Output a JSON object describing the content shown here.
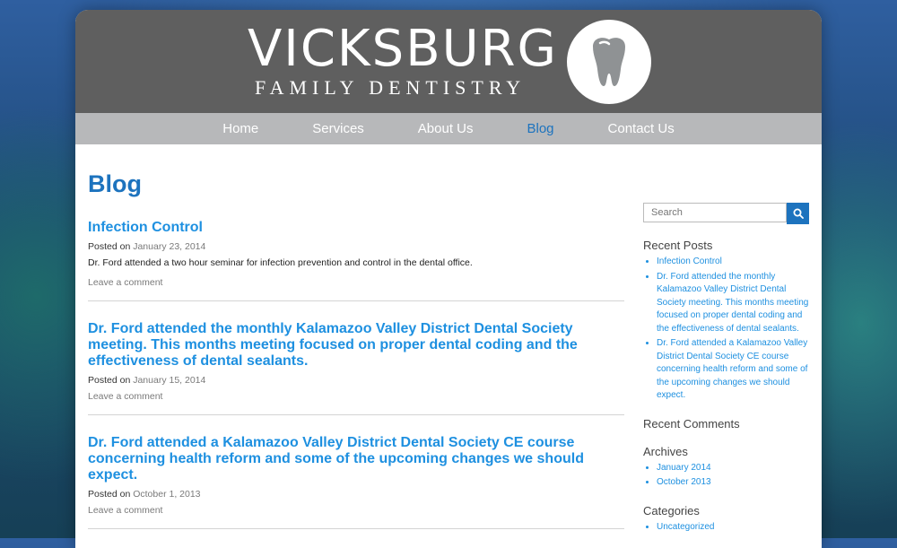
{
  "brand": {
    "title": "VICKSBURG",
    "subtitle": "FAMILY DENTISTRY"
  },
  "nav": {
    "items": [
      {
        "label": "Home"
      },
      {
        "label": "Services"
      },
      {
        "label": "About Us"
      },
      {
        "label": "Blog"
      },
      {
        "label": "Contact Us"
      }
    ],
    "active": "Blog"
  },
  "page": {
    "title": "Blog"
  },
  "posts": [
    {
      "title": "Infection Control",
      "posted_on": "Posted on",
      "date": "January 23, 2014",
      "excerpt": "Dr. Ford attended a two hour seminar for infection prevention and control in the dental office.",
      "comment": "Leave a comment"
    },
    {
      "title": "Dr. Ford attended the monthly Kalamazoo Valley District Dental Society meeting. This months meeting focused on proper dental coding and the effectiveness of dental sealants.",
      "posted_on": "Posted on",
      "date": "January 15, 2014",
      "comment": "Leave a comment"
    },
    {
      "title": "Dr. Ford attended a Kalamazoo Valley District Dental Society CE course concerning health reform and some of the upcoming changes we should expect.",
      "posted_on": "Posted on",
      "date": "October 1, 2013",
      "comment": "Leave a comment"
    }
  ],
  "sidebar": {
    "search_placeholder": "Search",
    "recent_posts_title": "Recent Posts",
    "recent_posts": [
      "Infection Control",
      "Dr. Ford attended the monthly Kalamazoo Valley District Dental Society meeting. This months meeting focused on proper dental coding and the effectiveness of dental sealants.",
      "Dr. Ford attended a Kalamazoo Valley District Dental Society CE course concerning health reform and some of the upcoming changes we should expect."
    ],
    "recent_comments_title": "Recent Comments",
    "archives_title": "Archives",
    "archives": [
      "January 2014",
      "October 2013"
    ],
    "categories_title": "Categories",
    "categories": [
      "Uncategorized"
    ]
  },
  "colors": {
    "header_bg": "#5f5f5f",
    "nav_bg": "#b7b8ba",
    "accent": "#1d73be",
    "link": "#1e90e0"
  },
  "icons": {
    "logo": "tooth-icon",
    "search": "search-icon"
  }
}
